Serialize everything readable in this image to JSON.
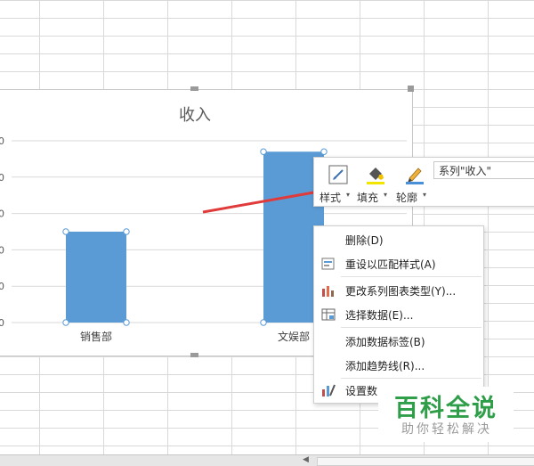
{
  "chart_data": {
    "type": "bar",
    "title": "收入",
    "categories": [
      "销售部",
      "文娱部"
    ],
    "series": [
      {
        "name": "收入",
        "values": [
          250,
          470
        ]
      }
    ],
    "ylim": [
      0,
      500
    ],
    "y_tick_labels_visible": [
      "0",
      "0",
      "0",
      "0",
      "0",
      "0"
    ],
    "grid": true,
    "bar_color": "#5b9bd5",
    "selected_series": "收入"
  },
  "mini_toolbar": {
    "style_label": "样式",
    "fill_label": "填充",
    "outline_label": "轮廓",
    "series_selector": "系列\"收入\""
  },
  "context_menu": {
    "items": [
      {
        "label": "删除(D)",
        "icon": ""
      },
      {
        "label": "重设以匹配样式(A)",
        "icon": "reset-style-icon"
      },
      {
        "label": "更改系列图表类型(Y)...",
        "icon": "change-chart-type-icon"
      },
      {
        "label": "选择数据(E)...",
        "icon": "select-data-icon"
      },
      {
        "label": "添加数据标签(B)",
        "icon": ""
      },
      {
        "label": "添加趋势线(R)...",
        "icon": ""
      },
      {
        "label": "设置数",
        "icon": "format-series-icon"
      }
    ]
  },
  "annotation": {
    "arrow_color": "#e03a3a"
  },
  "watermark": {
    "title": "百科全说",
    "subtitle": "助你轻松解决"
  }
}
